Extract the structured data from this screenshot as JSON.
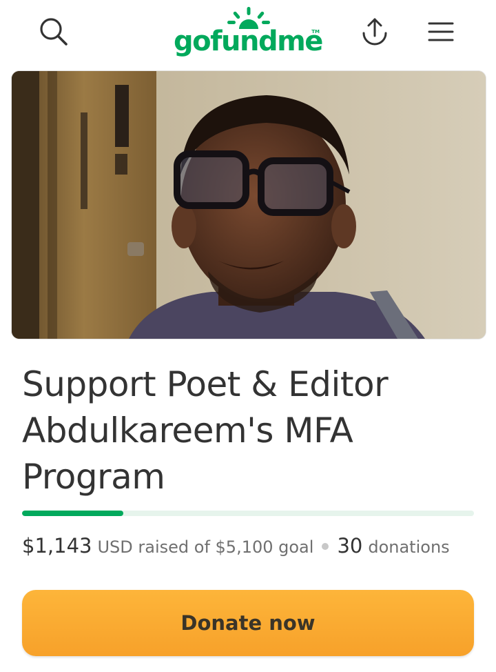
{
  "header": {
    "logo_text": "gofundme",
    "logo_tm": "TM",
    "icons": [
      "search-icon",
      "share-icon",
      "menu-icon"
    ]
  },
  "campaign": {
    "image_alt": "Campaign photo of Abdulkareem",
    "title": "Support Poet & Editor Abdulkareem's MFA Program",
    "raised": "$1,143",
    "raised_suffix": "USD raised of $5,100 goal",
    "donations_count": "30",
    "donations_label": "donations",
    "progress_percent": 22.4
  },
  "actions": {
    "donate_label": "Donate now"
  },
  "colors": {
    "brand_green": "#02a95c",
    "donate_orange": "#fbaf37",
    "progress_track": "#e6f4ec",
    "text": "#333333"
  }
}
